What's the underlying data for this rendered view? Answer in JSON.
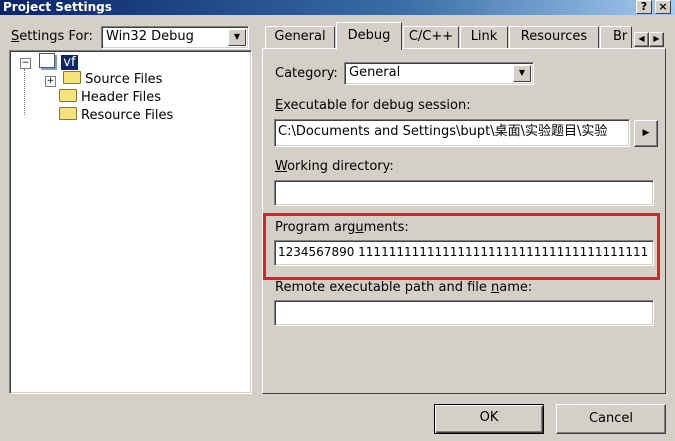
{
  "window": {
    "title": "Project Settings"
  },
  "title_buttons": {
    "help": "?",
    "close": "×"
  },
  "settings_for": {
    "label_u": "S",
    "label_rest": "ettings For:",
    "value": "Win32 Debug"
  },
  "tree": {
    "root": "vf",
    "items": [
      {
        "label": "Source Files"
      },
      {
        "label": "Header Files"
      },
      {
        "label": "Resource Files"
      }
    ]
  },
  "tabs": [
    "General",
    "Debug",
    "C/C++",
    "Link",
    "Resources",
    "Br"
  ],
  "category": {
    "label": "Category:",
    "value": "General"
  },
  "executable": {
    "label_u": "E",
    "label_rest": "xecutable for debug session:",
    "value": "C:\\Documents and Settings\\bupt\\桌面\\实验题目\\实验"
  },
  "working_dir": {
    "label_u": "W",
    "label_rest": "orking directory:",
    "value": ""
  },
  "program_args": {
    "label_pre": "Program arg",
    "label_u": "u",
    "label_post": "ments:",
    "value": "1234567890 11111111111111111111111111111111111111"
  },
  "remote": {
    "label_pre": "Remote executable path and file ",
    "label_u": "n",
    "label_post": "ame:",
    "value": ""
  },
  "buttons": {
    "ok": "OK",
    "cancel": "Cancel"
  },
  "colors": {
    "title_start": "#0a246a",
    "title_end": "#a6caf0",
    "highlight": "#e02020",
    "selection": "#0a246a"
  }
}
